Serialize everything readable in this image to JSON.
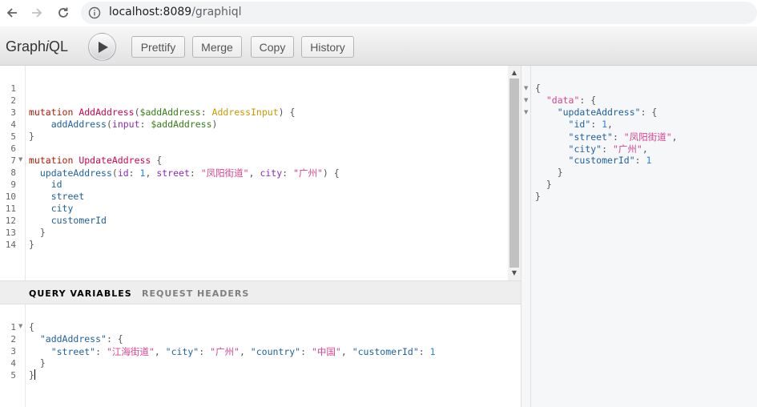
{
  "browser": {
    "url_host": "localhost:8089",
    "url_path": "/graphiql"
  },
  "toolbar": {
    "title_prefix": "Graph",
    "title_italic": "i",
    "title_suffix": "QL",
    "prettify": "Prettify",
    "merge": "Merge",
    "copy": "Copy",
    "history": "History"
  },
  "query": {
    "line_numbers": [
      "1",
      "2",
      "3",
      "4",
      "5",
      "6",
      "7",
      "8",
      "9",
      "10",
      "11",
      "12",
      "13",
      "14"
    ],
    "lines": {
      "l3_kw": "mutation",
      "l3_name": "AddAddress",
      "l3_var": "$addAddress",
      "l3_type": "AddressInput",
      "l4_field": "addAddress",
      "l4_arg": "input",
      "l4_var": "$addAddress",
      "l7_kw": "mutation",
      "l7_name": "UpdateAddress",
      "l8_field": "updateAddress",
      "l8_arg1": "id",
      "l8_val1": "1",
      "l8_arg2": "street",
      "l8_val2": "\"凤阳街道\"",
      "l8_arg3": "city",
      "l8_val3": "\"广州\"",
      "l9": "id",
      "l10": "street",
      "l11": "city",
      "l12": "customerId"
    }
  },
  "variables": {
    "tab_active": "QUERY VARIABLES",
    "tab_inactive": "REQUEST HEADERS",
    "line_numbers": [
      "1",
      "2",
      "3",
      "4",
      "5"
    ],
    "key_add": "\"addAddress\"",
    "k_street": "\"street\"",
    "v_street": "\"江海街道\"",
    "k_city": "\"city\"",
    "v_city": "\"广州\"",
    "k_country": "\"country\"",
    "v_country": "\"中国\"",
    "k_customer": "\"customerId\"",
    "v_customer": "1"
  },
  "result": {
    "k_data": "\"data\"",
    "k_update": "\"updateAddress\"",
    "k_id": "\"id\"",
    "v_id": "1",
    "k_street": "\"street\"",
    "v_street": "\"凤阳街道\"",
    "k_city": "\"city\"",
    "v_city": "\"广州\"",
    "k_customer": "\"customerId\"",
    "v_customer": "1"
  }
}
